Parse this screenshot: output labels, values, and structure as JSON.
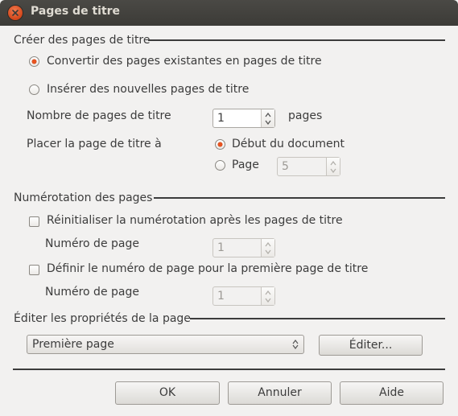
{
  "window": {
    "title": "Pages de titre"
  },
  "create_section": {
    "label": "Créer des pages de titre",
    "convert_radio_label": "Convertir des pages existantes en pages de titre",
    "insert_radio_label": "Insérer des nouvelles pages de titre",
    "count_label": "Nombre de pages de titre",
    "count_value": "1",
    "count_unit": "pages",
    "place_label": "Placer la page de titre à",
    "start_radio_label": "Début du document",
    "page_radio_label": "Page",
    "page_value": "5"
  },
  "numbering_section": {
    "label": "Numérotation des pages",
    "reset_checkbox_label": "Réinitialiser la numérotation après les pages de titre",
    "reset_page_label": "Numéro de page",
    "reset_page_value": "1",
    "set_checkbox_label": "Définir le numéro de page pour la première page de titre",
    "set_page_label": "Numéro de page",
    "set_page_value": "1"
  },
  "edit_section": {
    "label": "Éditer les propriétés de la page",
    "style_value": "Première page",
    "edit_button": "Éditer..."
  },
  "buttons": {
    "ok": "OK",
    "cancel": "Annuler",
    "help": "Aide"
  },
  "colors": {
    "accent": "#e95420",
    "titlebar": "#3c3b37",
    "dialog_bg": "#f2f1f0"
  }
}
